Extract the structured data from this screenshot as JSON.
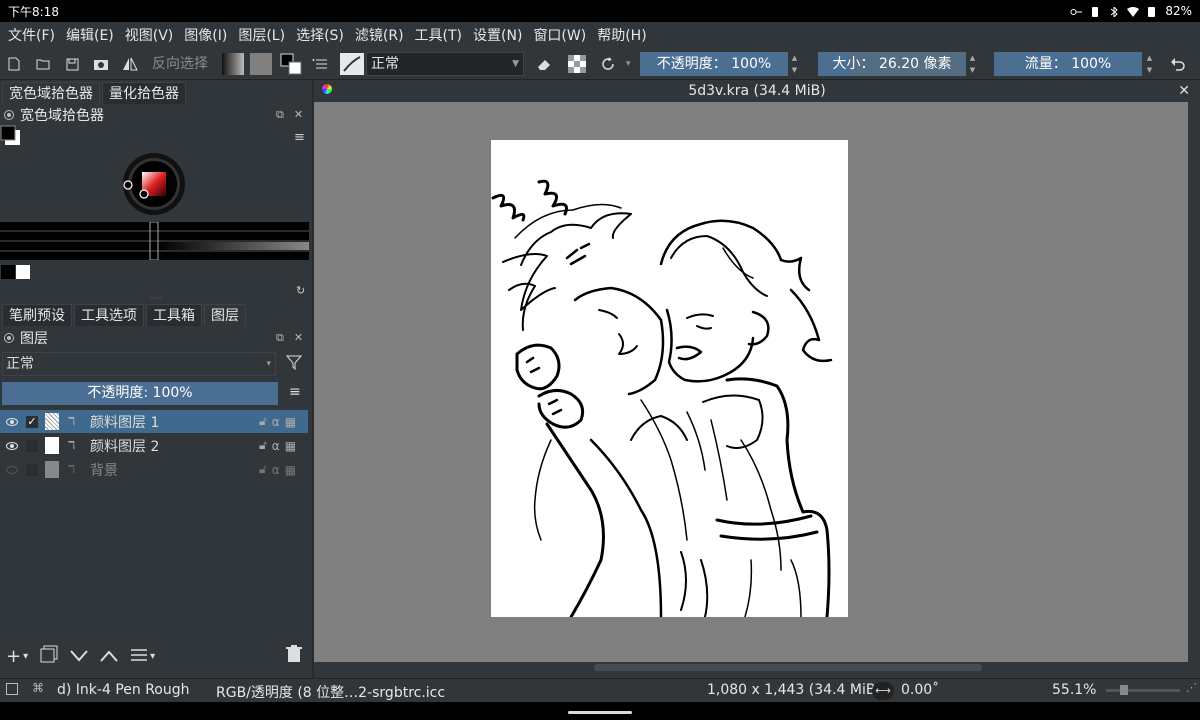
{
  "status": {
    "time": "下午8:18",
    "battery": "82%"
  },
  "menu": [
    "文件(F)",
    "编辑(E)",
    "视图(V)",
    "图像(I)",
    "图层(L)",
    "选择(S)",
    "滤镜(R)",
    "工具(T)",
    "设置(N)",
    "窗口(W)",
    "帮助(H)"
  ],
  "toolbar": {
    "invert_selection": "反向选择",
    "blend_mode": "正常",
    "opacity": "不透明度： 100%",
    "size_label": "大小",
    "size_value": "： 26.20 像素",
    "flow": "流量： 100%"
  },
  "colors": {
    "accent": "#4a6f92",
    "selected_row": "#3f6a8e",
    "panel": "#31363b",
    "canvas_bg": "#808080"
  },
  "top_docker": {
    "tabs": [
      "宽色域拾色器",
      "量化拾色器"
    ],
    "title": "宽色域拾色器"
  },
  "bottom_docker": {
    "tabs": [
      "笔刷预设",
      "工具选项",
      "工具箱",
      "图层"
    ],
    "title": "图层",
    "blend_mode": "正常",
    "opacity": "不透明度:  100%",
    "layers": [
      {
        "name": "颜料图层 1",
        "visible": true,
        "active": true,
        "checked": "✓"
      },
      {
        "name": "颜料图层 2",
        "visible": true,
        "active": false,
        "checked": ""
      },
      {
        "name": "背景",
        "visible": false,
        "active": false,
        "checked": ""
      }
    ]
  },
  "document": {
    "tab_title": "5d3v.kra (34.4 MiB)"
  },
  "statusbar": {
    "brush": "d) Ink-4 Pen Rough",
    "colorspace": "RGB/透明度 (8 位整…2-srgbtrc.icc",
    "dimensions": "1,080 x 1,443 (34.4 MiB)",
    "rotation": "0.00˚",
    "zoom": "55.1%"
  }
}
